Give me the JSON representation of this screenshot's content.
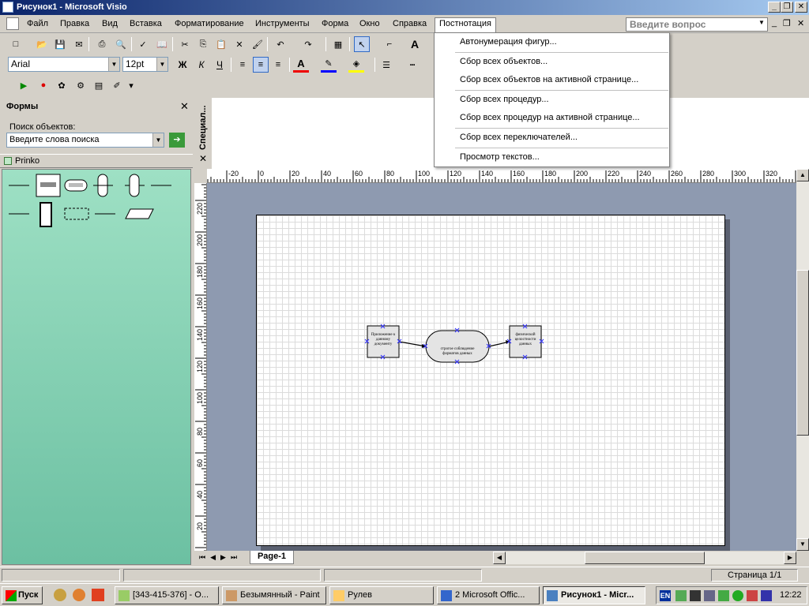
{
  "title_bar": {
    "title": "Рисунок1 - Microsoft Visio"
  },
  "menu": {
    "items": [
      "Файл",
      "Правка",
      "Вид",
      "Вставка",
      "Форматирование",
      "Инструменты",
      "Форма",
      "Окно",
      "Справка",
      "Постнотация"
    ],
    "question_placeholder": "Введите вопрос"
  },
  "format_toolbar": {
    "font": "Arial",
    "size": "12pt",
    "bold": "Ж",
    "italic": "К",
    "underline": "Ч",
    "font_color_label": "A"
  },
  "standard_toolbar": {
    "text_tool": "A"
  },
  "shapes_panel": {
    "title": "Формы",
    "search_label": "Поиск объектов:",
    "search_placeholder": "Введите слова поиска",
    "stencil_name": "Prinko"
  },
  "special_panel": {
    "title": "Специал..."
  },
  "dropdown": {
    "items": [
      "Автонумерация фигур...",
      "Сбор всех объектов...",
      "Сбор всех объектов на активной странице...",
      "Сбор всех процедур...",
      "Сбор всех процедур на активной странице...",
      "Сбор всех переключателей...",
      "Просмотр текстов..."
    ]
  },
  "rulers": {
    "horizontal": [
      "-20",
      "0",
      "20",
      "40",
      "60",
      "80",
      "100",
      "120",
      "140",
      "160",
      "180",
      "200",
      "220",
      "240",
      "260",
      "280",
      "300",
      "320"
    ],
    "vertical": [
      "220",
      "200",
      "180",
      "160",
      "140",
      "120",
      "100",
      "80",
      "60",
      "40",
      "20"
    ]
  },
  "diagram": {
    "left_box": "Приложение к данному документу",
    "center": "строгое соблюдение форматов данных",
    "right_box": "физической целостности данных"
  },
  "page_tab": "Page-1",
  "status": {
    "page": "Страница 1/1"
  },
  "taskbar": {
    "start": "Пуск",
    "tasks": [
      "[343-415-376] - О...",
      "Безымянный - Paint",
      "Рулев",
      "2 Microsoft Offic...",
      "Рисунок1 - Micr..."
    ],
    "clock": "12:22"
  }
}
